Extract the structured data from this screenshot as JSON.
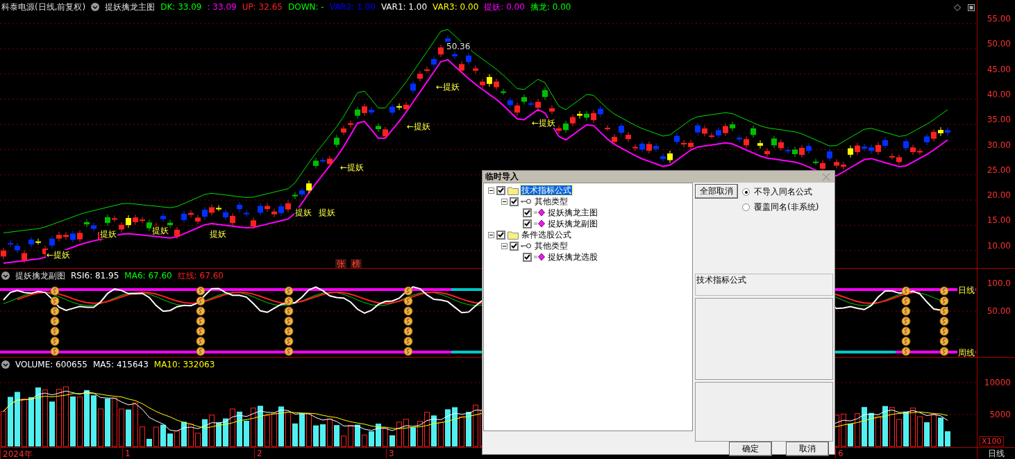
{
  "main_chart": {
    "stock_title": "科泰电源(日线,前复权)",
    "indicator_name": "提妖擒龙主图",
    "legend": [
      {
        "text": "DK: 33.09",
        "color": "#00ff00"
      },
      {
        "text": ": 33.09",
        "color": "#ff00ff"
      },
      {
        "text": "UP: 32.65",
        "color": "#ff2020"
      },
      {
        "text": "DOWN: -",
        "color": "#00ff00"
      },
      {
        "text": "VAR2: 1.00",
        "color": "#0000ff"
      },
      {
        "text": "VAR1: 1.00",
        "color": "#ffffff"
      },
      {
        "text": "VAR3: 0.00",
        "color": "#ffff00"
      },
      {
        "text": "提妖: 0.00",
        "color": "#ff00ff"
      },
      {
        "text": "擒龙: 0.00",
        "color": "#00ff00"
      }
    ],
    "annotations": [
      {
        "text": "←提妖",
        "kind": "signal"
      },
      {
        "text": "提妖",
        "kind": "signal"
      },
      {
        "text": "提妖",
        "kind": "signal"
      },
      {
        "text": "提妖",
        "kind": "signal"
      },
      {
        "text": "提妖",
        "kind": "signal"
      },
      {
        "text": "提妖",
        "kind": "signal"
      },
      {
        "text": "←提妖",
        "kind": "signal"
      },
      {
        "text": "←提妖",
        "kind": "signal"
      },
      {
        "text": "←提妖",
        "kind": "signal"
      },
      {
        "text": "←提妖",
        "kind": "signal"
      },
      {
        "text": "50.36",
        "kind": "price"
      },
      {
        "text": "张",
        "kind": "tag"
      },
      {
        "text": "榜",
        "kind": "tag"
      }
    ],
    "axis_ticks": [
      "55.00",
      "50.00",
      "45.00",
      "40.00",
      "35.00",
      "30.00",
      "25.00",
      "20.00",
      "15.00",
      "10.00"
    ]
  },
  "sub_chart": {
    "indicator_name": "提妖擒龙副图",
    "legend": [
      {
        "text": "RSI6: 81.95",
        "color": "#ffffff"
      },
      {
        "text": "MA6: 67.60",
        "color": "#00ff00"
      },
      {
        "text": "红线: 67.60",
        "color": "#ff2020"
      }
    ],
    "line_labels": [
      "日线",
      "周线"
    ],
    "axis_ticks": [
      "100.0",
      "50.00"
    ]
  },
  "volume_chart": {
    "legend": [
      {
        "text": "VOLUME: 600655",
        "color": "#ffffff"
      },
      {
        "text": "MA5: 415643",
        "color": "#ffffff"
      },
      {
        "text": "MA10: 332063",
        "color": "#ffff00"
      }
    ],
    "axis_ticks": [
      "10000",
      "5000"
    ],
    "unit": "X100"
  },
  "time_axis": {
    "labels": [
      "2024年",
      "1",
      "2",
      "3",
      "6"
    ],
    "period": "日线"
  },
  "dialog": {
    "title": "临时导入",
    "tree": [
      {
        "label": "技术指标公式",
        "kind": "folder",
        "checked": true,
        "expanded": true,
        "selected": true,
        "children": [
          {
            "label": "其他类型",
            "kind": "category",
            "checked": true,
            "expanded": true,
            "selected": false,
            "children": [
              {
                "label": "捉妖擒龙主图",
                "kind": "formula",
                "checked": true,
                "selected": false
              },
              {
                "label": "捉妖擒龙副图",
                "kind": "formula",
                "checked": true,
                "selected": false
              }
            ]
          }
        ]
      },
      {
        "label": "条件选股公式",
        "kind": "folder",
        "checked": true,
        "expanded": true,
        "selected": false,
        "children": [
          {
            "label": "其他类型",
            "kind": "category",
            "checked": true,
            "expanded": true,
            "selected": false,
            "children": [
              {
                "label": "捉妖擒龙选股",
                "kind": "formula",
                "checked": true,
                "selected": false
              }
            ]
          }
        ]
      }
    ],
    "cancel_all_button": "全部取消",
    "options": [
      {
        "label": "不导入同名公式",
        "selected": true
      },
      {
        "label": "覆盖同名(非系统)",
        "selected": false
      }
    ],
    "info_text": "技术指标公式",
    "ok_button": "确定",
    "cancel_button": "取消"
  }
}
